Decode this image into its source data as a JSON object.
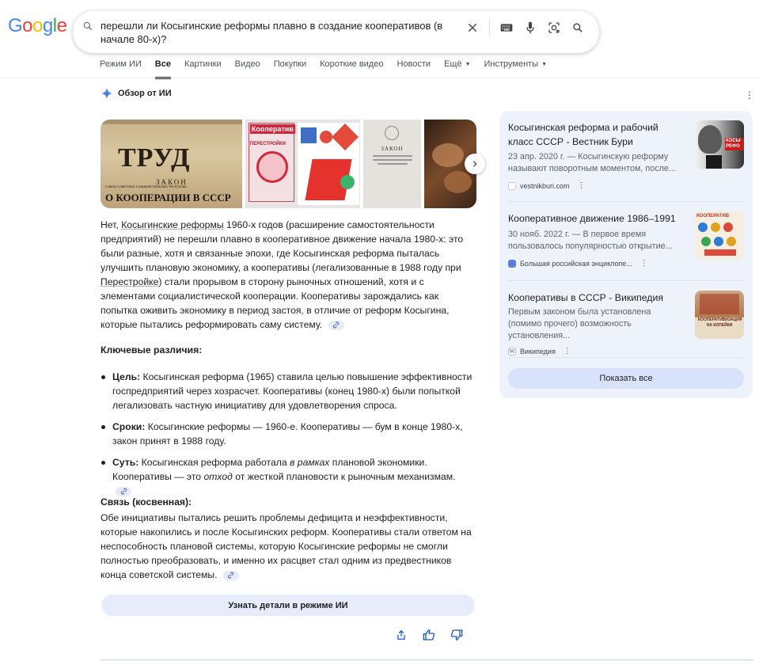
{
  "logo": {
    "text": "Google"
  },
  "search": {
    "query": "перешли ли Косыгинские реформы плавно в создание кооперативов (в начале 80-х)?"
  },
  "tabs": [
    {
      "label": "Режим ИИ"
    },
    {
      "label": "Все"
    },
    {
      "label": "Картинки"
    },
    {
      "label": "Видео"
    },
    {
      "label": "Покупки"
    },
    {
      "label": "Короткие видео"
    },
    {
      "label": "Новости"
    },
    {
      "label": "Ещё"
    },
    {
      "label": "Инструменты"
    }
  ],
  "ai_overview": {
    "title": "Обзор от ИИ",
    "images": [
      {
        "caption_top": "ТРУД",
        "caption_mid": "ЗАКОН",
        "caption_sub": "Союза Советских Социалистических Республик",
        "caption_bottom": "О КООПЕРАЦИИ В СССР"
      },
      {
        "caption_top": "Кооператив",
        "caption_mid": "ПЕРЕСТРОЙКИ"
      },
      {
        "caption_top": "ЗАКОН"
      },
      {}
    ],
    "p1": {
      "a": "Нет, ",
      "link1": "Косыгинские реформы",
      "b": " 1960-х годов (расширение самостоятельности предприятий) не перешли плавно в кооперативное движение начала 1980-х: это были разные, хотя и связанные эпохи, где Косыгинская реформа пыталась улучшить плановую экономику, а кооперативы (легализованные в 1988 году при ",
      "link2": "Перестройке",
      "c": ") стали прорывом в сторону рыночных отношений, хотя и с элементами социалистической кооперации. Кооперативы зарождались как попытка оживить экономику в период застоя, в отличие от реформ Косыгина, которые пытались реформировать саму систему."
    },
    "key_heading": "Ключевые различия:",
    "bullets": [
      {
        "label": "Цель:",
        "text": " Косыгинская реформа (1965) ставила целью повышение эффективности госпредприятий через хозрасчет. Кооперативы (конец 1980-х) были попыткой легализовать частную инициативу для удовлетворения спроса."
      },
      {
        "label": "Сроки:",
        "text": " Косыгинские реформы — 1960-е. Кооперативы — бум в конце 1980-х, закон принят в 1988 году."
      },
      {
        "label": "Суть:",
        "t1": " Косыгинская реформа работала ",
        "em1": "в рамках",
        "t2": " плановой экономики. Кооперативы — это ",
        "em2": "отход",
        "t3": " от жесткой плановости к рыночным механизмам."
      }
    ],
    "link_heading": "Связь (косвенная):",
    "p2": "Обе инициативы пытались решить проблемы дефицита и неэффективности, которые накопились и после Косыгинских реформ. Кооперативы стали ответом на неспособность плановой системы, которую Косыгинские реформы не смогли полностью преобразовать, и именно их расцвет стал одним из предвестников конца советской системы.",
    "ai_mode_button": "Узнать детали в режиме ИИ"
  },
  "sources": {
    "items": [
      {
        "title": "Косыгинская реформа и рабочий класс СССР - Вестник Бури",
        "snippet": "23 апр. 2020 г. — Косыгинскую реформу называют поворотным моментом, после...",
        "site": "vestnikburi.com",
        "thumb_text": "КОСЫ РЕФО"
      },
      {
        "title": "Кооперативное движение 1986–1991",
        "snippet": "30 нояб. 2022 г. — В первое время пользовалось популярностью открытие...",
        "site": "Большая российская энциклопе...",
        "thumb_text": "КООПЕРАТИВ"
      },
      {
        "title": "Кооперативы в СССР - Википедия",
        "snippet": "Первым законом была установлена (помимо прочего) возможность установления...",
        "site": "Википедия",
        "thumb_text": "КООПЕРАТИВИЗАЦИЯ НА КОПЕЙКИ"
      }
    ],
    "show_all": "Показать все"
  }
}
